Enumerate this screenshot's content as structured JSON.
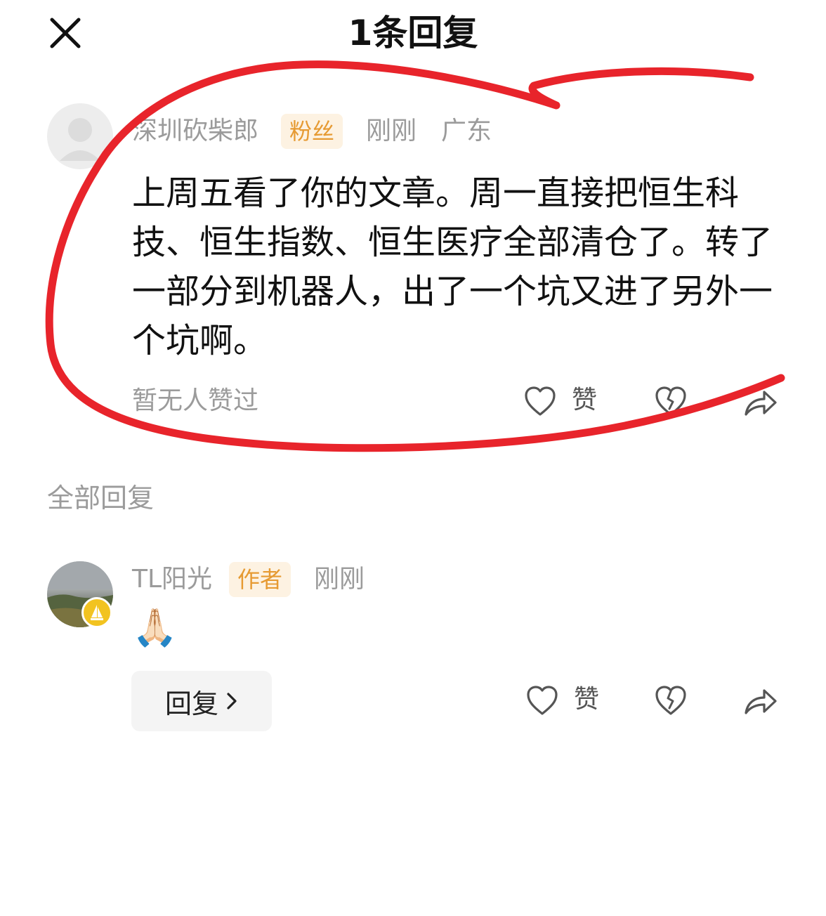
{
  "header": {
    "title": "1条回复",
    "close_icon": "close-icon"
  },
  "comment": {
    "username": "深圳砍柴郎",
    "tag": "粉丝",
    "time": "刚刚",
    "location": "广东",
    "text": "上周五看了你的文章。周一直接把恒生科技、恒生指数、恒生医疗全部清仓了。转了一部分到机器人，出了一个坑又进了另外一个坑啊。",
    "likes_text": "暂无人赞过",
    "like_label": "赞"
  },
  "replies_section": {
    "title": "全部回复"
  },
  "reply": {
    "username": "TL阳光",
    "tag": "作者",
    "time": "刚刚",
    "emoji": "🙏🏻",
    "reply_button_label": "回复",
    "like_label": "赞"
  },
  "colors": {
    "tag_bg": "#fdf2e2",
    "tag_text": "#e69a32",
    "muted_text": "#9b9b9b",
    "annotation_red": "#e8242b",
    "vip_badge": "#f2c320"
  }
}
